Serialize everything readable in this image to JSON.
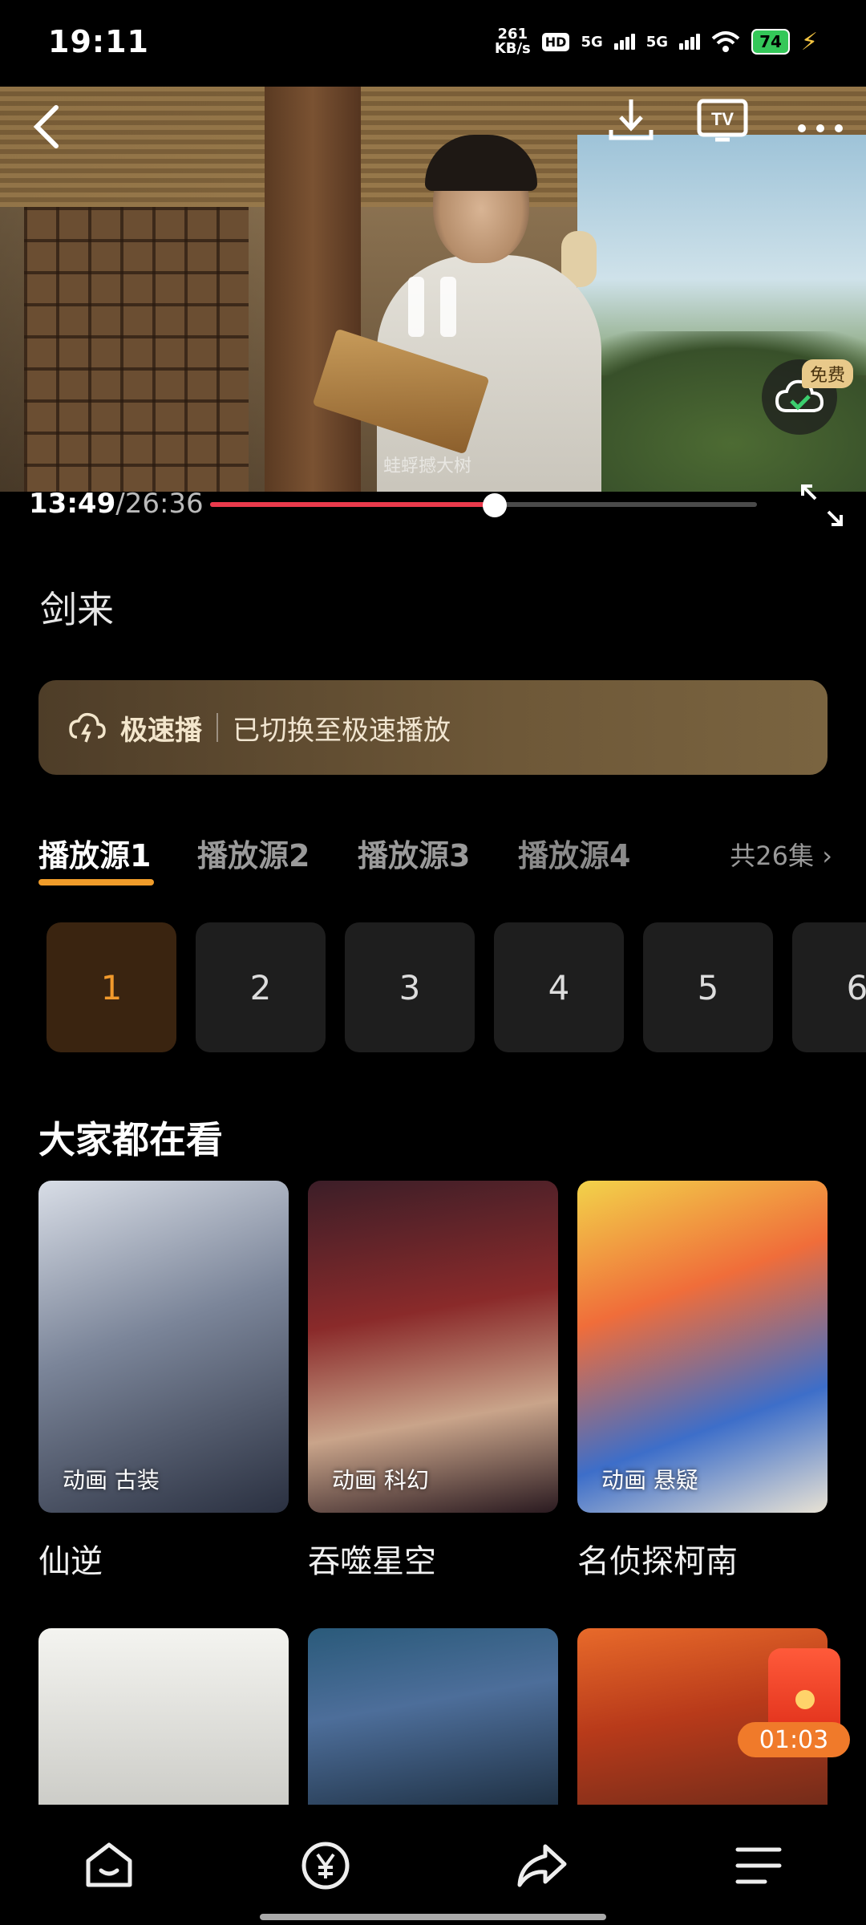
{
  "status_bar": {
    "time": "19:11",
    "net_speed_value": "261",
    "net_speed_unit": "KB/s",
    "hd_label": "HD",
    "network_1": "5G",
    "network_2": "5G",
    "battery": "74"
  },
  "player": {
    "watermark": "蛙蜉撼大树",
    "current_time": "13:49",
    "total_time": "/26:36",
    "progress": 0.52,
    "free_badge": "免费",
    "tv_label": "TV"
  },
  "show": {
    "title": "剑来"
  },
  "speed_banner": {
    "label": "极速播",
    "message": "已切换至极速播放"
  },
  "sources": {
    "tabs": [
      {
        "label": "播放源1",
        "active": true
      },
      {
        "label": "播放源2",
        "active": false
      },
      {
        "label": "播放源3",
        "active": false
      },
      {
        "label": "播放源4",
        "active": false
      }
    ],
    "episode_count": "共26集 ›"
  },
  "episodes": [
    "1",
    "2",
    "3",
    "4",
    "5",
    "6"
  ],
  "recommendations": {
    "heading": "大家都在看",
    "items": [
      {
        "title": "仙逆",
        "tag": "动画 古装"
      },
      {
        "title": "吞噬星空",
        "tag": "动画 科幻"
      },
      {
        "title": "名侦探柯南",
        "tag": "动画 悬疑"
      }
    ]
  },
  "floating_reward": {
    "timer": "01:03"
  },
  "bottom_nav": {
    "items": [
      "home-icon",
      "coin-icon",
      "share-icon",
      "menu-icon"
    ]
  },
  "colors": {
    "accent": "#f09c2a",
    "progress": "#ea3a4c",
    "active_episode_bg": "#3a2410"
  }
}
